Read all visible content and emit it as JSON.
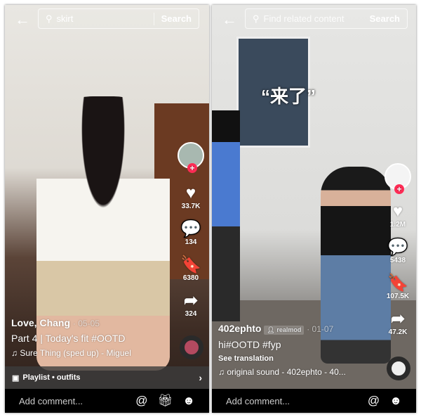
{
  "left": {
    "search": {
      "query": "skirt",
      "button": "Search"
    },
    "actions": [
      {
        "icon": "heart-icon",
        "count": "33.7K"
      },
      {
        "icon": "comment-icon",
        "count": "134"
      },
      {
        "icon": "bookmark-icon",
        "count": "6380"
      },
      {
        "icon": "share-icon",
        "count": "324"
      }
    ],
    "author": "Love, Chang",
    "date": "· 05-05",
    "description": "Part 4 | Today's fit #OOTD",
    "music": "♫ Sure Thing (sped up) - Miguel",
    "playlist": "Playlist • outfits",
    "comment_placeholder": "Add comment..."
  },
  "right": {
    "search": {
      "placeholder": "Find related content",
      "button": "Search"
    },
    "overlay_text": "“来了”",
    "actions": [
      {
        "icon": "heart-icon",
        "count": "1.2M"
      },
      {
        "icon": "comment-icon",
        "count": "5438"
      },
      {
        "icon": "bookmark-icon",
        "count": "107.5K"
      },
      {
        "icon": "share-icon",
        "count": "47.2K"
      }
    ],
    "author": "402ephto",
    "badge": "realmod",
    "date": "· 01-07",
    "description": "hi#OOTD #fyp",
    "see_translation": "See translation",
    "music": "♫ original sound - 402ephto - 40...",
    "comment_placeholder": "Add comment..."
  },
  "colors": {
    "accent": "#fe2c55",
    "bar": "#000000"
  }
}
